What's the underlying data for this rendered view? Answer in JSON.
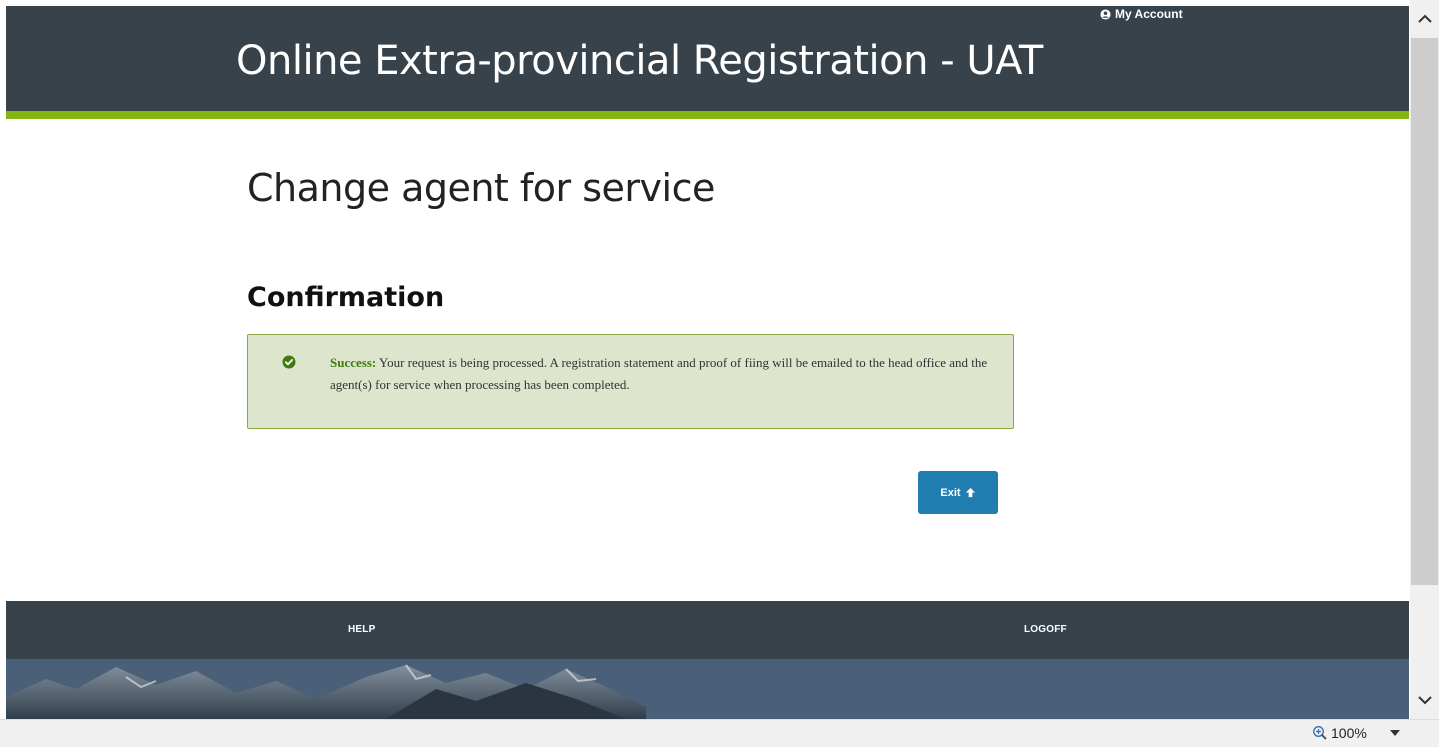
{
  "header": {
    "my_account_label": "My Account",
    "site_title": "Online Extra-provincial Registration - UAT"
  },
  "main": {
    "page_title": "Change agent for service",
    "section_heading": "Confirmation",
    "alert": {
      "strong_label": "Success:",
      "message": " Your request is being processed. A registration statement and proof of fiing will be emailed to the head office and the agent(s) for service when processing has been completed."
    },
    "exit_label": "Exit"
  },
  "footer": {
    "help_label": "HELP",
    "logoff_label": "LOGOFF"
  },
  "statusbar": {
    "zoom_level": "100%"
  },
  "colors": {
    "header_bg": "#37424a",
    "accent_green": "#82b611",
    "success_bg": "#dde5cc",
    "success_green": "#3f7a0f",
    "button_blue": "#1f7db0"
  }
}
